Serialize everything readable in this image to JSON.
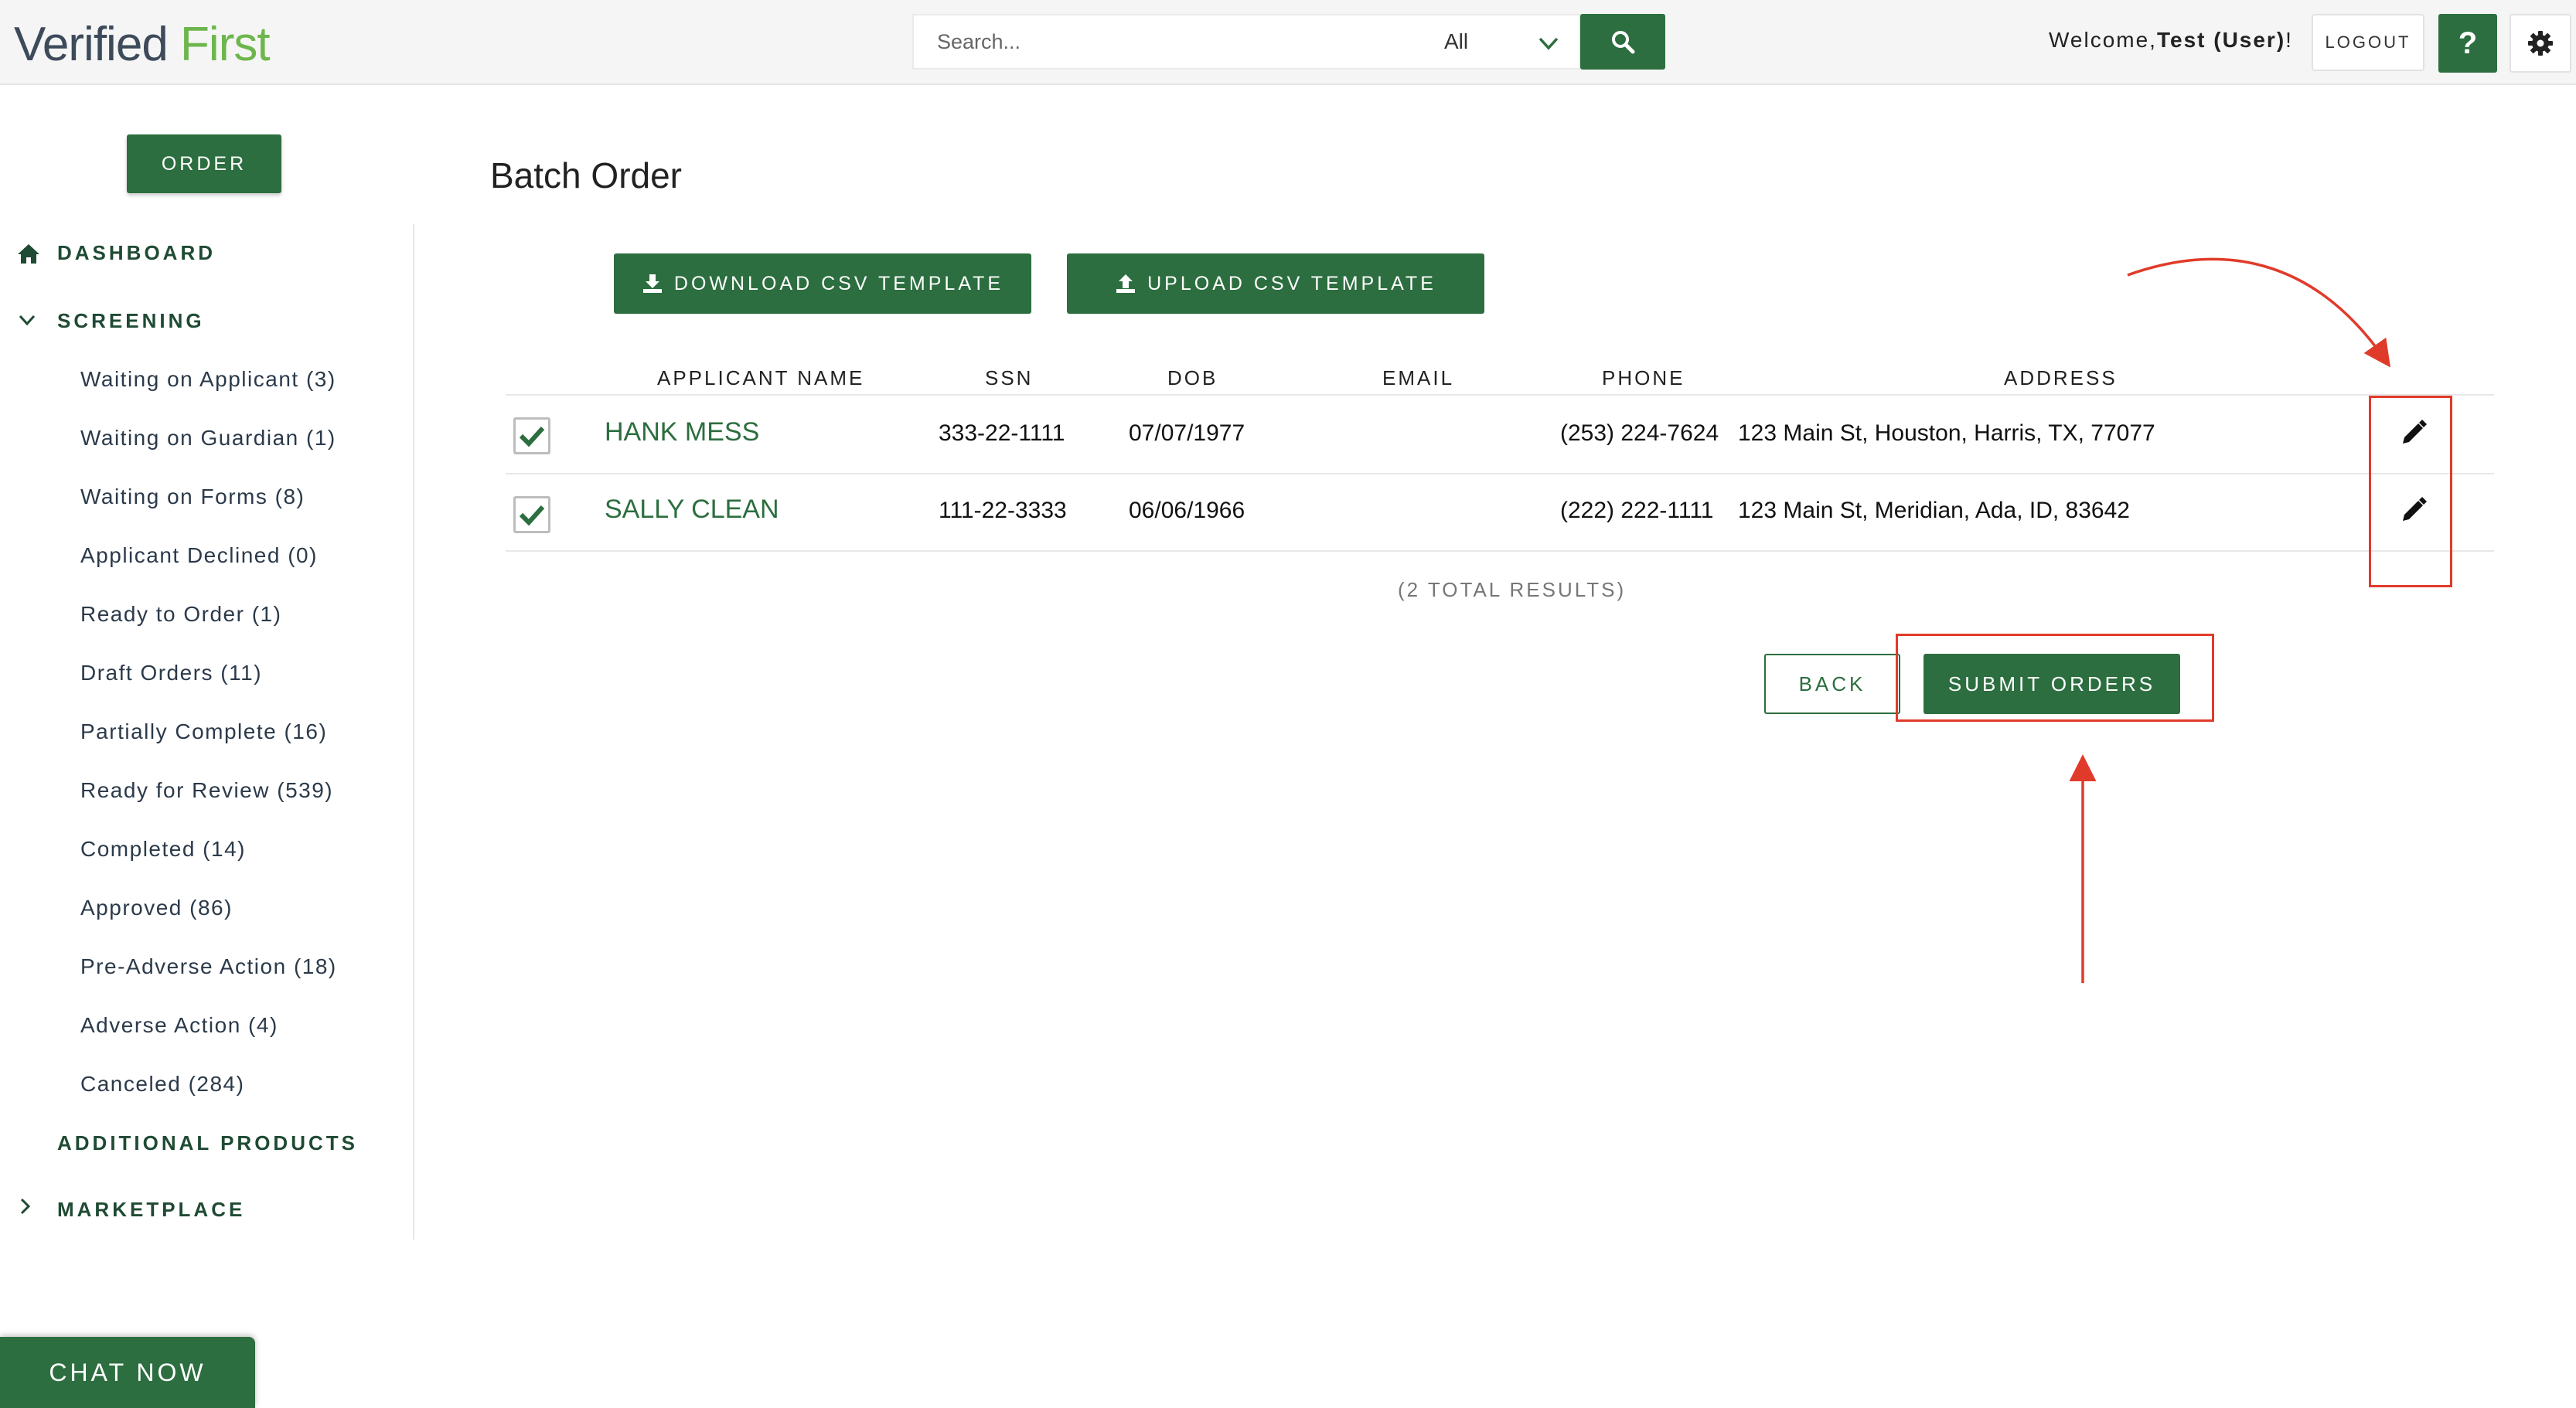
{
  "header": {
    "logo_part1": "Verified",
    "logo_part2": "First",
    "search_placeholder": "Search...",
    "search_filter": "All",
    "welcome_prefix": "Welcome,",
    "welcome_user": "Test (User)",
    "welcome_suffix": "!",
    "logout_label": "LOGOUT",
    "help_label": "?"
  },
  "sidebar": {
    "order_label": "ORDER",
    "dashboard_label": "DASHBOARD",
    "screening_label": "SCREENING",
    "screening_items": [
      "Waiting on Applicant (3)",
      "Waiting on Guardian (1)",
      "Waiting on Forms (8)",
      "Applicant Declined (0)",
      "Ready to Order (1)",
      "Draft Orders (11)",
      "Partially Complete (16)",
      "Ready for Review (539)",
      "Completed (14)",
      "Approved (86)",
      "Pre-Adverse Action (18)",
      "Adverse Action (4)",
      "Canceled (284)"
    ],
    "additional_products_label": "ADDITIONAL PRODUCTS",
    "marketplace_label": "MARKETPLACE"
  },
  "main": {
    "title": "Batch Order",
    "download_label": "DOWNLOAD CSV TEMPLATE",
    "upload_label": "UPLOAD CSV TEMPLATE",
    "columns": [
      "APPLICANT NAME",
      "SSN",
      "DOB",
      "EMAIL",
      "PHONE",
      "ADDRESS"
    ],
    "rows": [
      {
        "name": "HANK MESS",
        "ssn": "333-22-1111",
        "dob": "07/07/1977",
        "email": "",
        "phone": "(253) 224-7624",
        "address": "123 Main St, Houston, Harris, TX, 77077",
        "checked": true
      },
      {
        "name": "SALLY CLEAN",
        "ssn": "111-22-3333",
        "dob": "06/06/1966",
        "email": "",
        "phone": "(222) 222-1111",
        "address": "123 Main St, Meridian, Ada, ID, 83642",
        "checked": true
      }
    ],
    "total_results": "(2 TOTAL RESULTS)",
    "back_label": "BACK",
    "submit_label": "SUBMIT ORDERS"
  },
  "chat_label": "CHAT NOW",
  "colors": {
    "brand_green": "#2c6e3f",
    "logo_green": "#6db64e",
    "annotation_red": "#e03b2a"
  }
}
